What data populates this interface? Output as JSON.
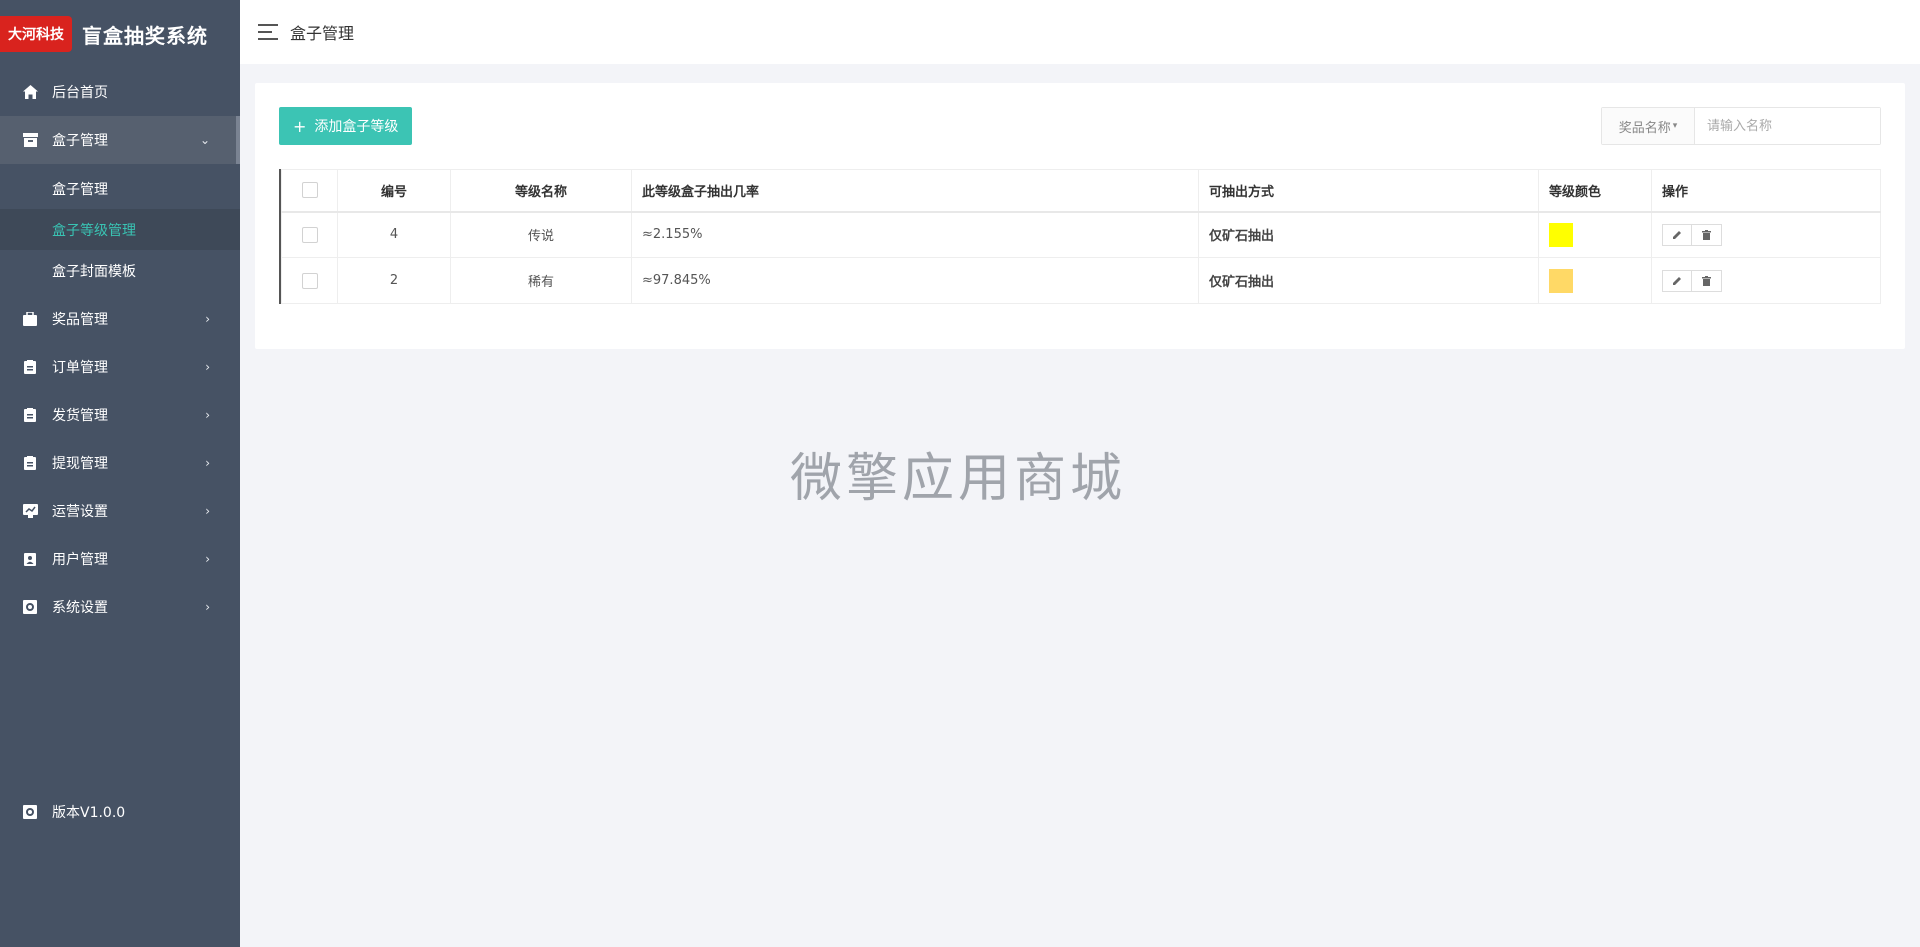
{
  "brand": {
    "logo_text": "大河科技",
    "title": "盲盒抽奖系统",
    "logo_color": "#d9231e"
  },
  "topbar": {
    "title": "盒子管理"
  },
  "sidebar": {
    "items": [
      {
        "label": "后台首页",
        "icon": "home-icon"
      },
      {
        "label": "盒子管理",
        "icon": "box-icon",
        "open": true,
        "children": [
          {
            "label": "盒子管理"
          },
          {
            "label": "盒子等级管理",
            "active": true
          },
          {
            "label": "盒子封面模板"
          }
        ]
      },
      {
        "label": "奖品管理",
        "icon": "bag-icon"
      },
      {
        "label": "订单管理",
        "icon": "clipboard-icon"
      },
      {
        "label": "发货管理",
        "icon": "clipboard-icon"
      },
      {
        "label": "提现管理",
        "icon": "clipboard-icon"
      },
      {
        "label": "运营设置",
        "icon": "chart-icon"
      },
      {
        "label": "用户管理",
        "icon": "user-badge-icon"
      },
      {
        "label": "系统设置",
        "icon": "gear-box-icon"
      }
    ],
    "version": "版本V1.0.0"
  },
  "toolbar": {
    "add_label": "添加盒子等级"
  },
  "search": {
    "select_label": "奖品名称",
    "placeholder": "请输入名称"
  },
  "table": {
    "headers": [
      "编号",
      "等级名称",
      "此等级盒子抽出几率",
      "可抽出方式",
      "等级颜色",
      "操作"
    ],
    "rows": [
      {
        "id": "4",
        "name": "传说",
        "rate": "≈2.155%",
        "method": "仅矿石抽出",
        "color": "#ffff00"
      },
      {
        "id": "2",
        "name": "稀有",
        "rate": "≈97.845%",
        "method": "仅矿石抽出",
        "color": "#ffd966"
      }
    ]
  },
  "watermark": "微擎应用商城",
  "colors": {
    "accent": "#3cc4b4",
    "sidebar_bg": "#465264",
    "active_text": "#39c3b3"
  }
}
